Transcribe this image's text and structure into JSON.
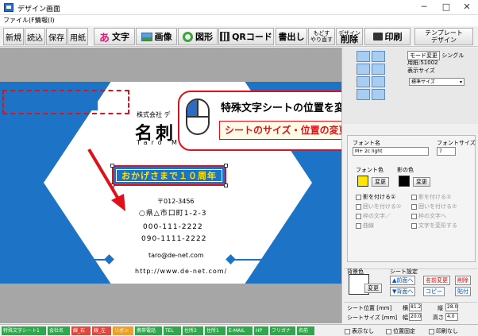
{
  "window": {
    "title": "デザイン画面",
    "min": "─",
    "max": "□",
    "close": "✕"
  },
  "menu": {
    "file": "ファイル(F)",
    "info": "情報(I)"
  },
  "toolbar": {
    "new": "新規",
    "open": "読込",
    "save": "保存",
    "paper": "用紙",
    "text": "文字",
    "text_icon": "あ",
    "image": "画像",
    "shape": "図形",
    "qr": "QRコード",
    "write": "書出し",
    "undo_line1": "もどす",
    "undo_line2": "やり直す",
    "delete_line1": "デザイン",
    "delete_line2": "削除",
    "print": "印刷",
    "template_line1": "テンプレート",
    "template_line2": "デザイン"
  },
  "card": {
    "company": "株式会社 デ",
    "name_jp": "名刺 ス",
    "name_en": "Taro M",
    "special_text": "おかげさまで１０周年",
    "postal": "〒012-3456",
    "address": "○県△市口町1-2-3",
    "phone1": "000-111-2222",
    "phone2": "090-1111-2222",
    "email": "taro@de-net.com",
    "url": "http://www.de-net.com/"
  },
  "callout": {
    "title": "特殊文字シートの位置を変更",
    "link": "シートのサイズ・位置の変更方法はこちら"
  },
  "panel": {
    "mode_change": "モード変更",
    "mode_single": "シングル",
    "paper_label": "用紙:51002",
    "display_size_label": "表示サイズ",
    "display_size_value": "標準サイズ",
    "font_name_label": "フォント名",
    "font_name_value": "M+ 2c light",
    "font_size_label": "フォントサイズ",
    "font_size_value": "7",
    "font_color_label": "フォント色",
    "shadow_color_label": "影の色",
    "change": "変更",
    "cb_shadow1": "影を付ける①",
    "cb_shadow2": "影を付ける②",
    "cb_outline1": "囲いを付ける①",
    "cb_outline2": "囲いを付ける②",
    "cb_vertical": "枠の文字／",
    "cb_outline_text": "枠の文字へ",
    "cb_curve": "曲線",
    "cb_transform": "文字を変形する",
    "bg_color_label": "背景色",
    "sheet_settings_label": "シート設定",
    "front": "▲前面へ",
    "name_change": "名前変更",
    "delete": "削除",
    "back": "▼背面へ",
    "copy": "コピー",
    "paste": "貼付",
    "sheet_pos_label": "シート位置 [mm]",
    "x_label": "横",
    "x_value": "81.2",
    "y_label": "縦",
    "y_value": "28.0",
    "sheet_size_label": "シートサイズ [mm]",
    "w_label": "幅",
    "w_value": "20.0",
    "h_label": "高さ",
    "h_value": "4.0",
    "hide": "表示なし",
    "lock": "位置固定",
    "no_print": "印刷なし"
  },
  "tabs": [
    {
      "label": "特殊文字シート1",
      "color": "#2ea84a"
    },
    {
      "label": "会社名",
      "color": "#2ea84a"
    },
    {
      "label": "線_右",
      "color": "#e2473b"
    },
    {
      "label": "線_左",
      "color": "#e2473b"
    },
    {
      "label": "リボン",
      "color": "#f0a020"
    },
    {
      "label": "携帯電話",
      "color": "#2ea84a"
    },
    {
      "label": "TEL",
      "color": "#2ea84a"
    },
    {
      "label": "住所2",
      "color": "#2ea84a"
    },
    {
      "label": "住所1",
      "color": "#2ea84a"
    },
    {
      "label": "E-MAIL",
      "color": "#2ea84a"
    },
    {
      "label": "HP",
      "color": "#2ea84a"
    },
    {
      "label": "フリガナ",
      "color": "#2ea84a"
    },
    {
      "label": "名前",
      "color": "#2ea84a"
    }
  ],
  "colors": {
    "brand_blue": "#1d73c5",
    "accent_red": "#e0101a",
    "special_yellow": "#ffe600"
  }
}
